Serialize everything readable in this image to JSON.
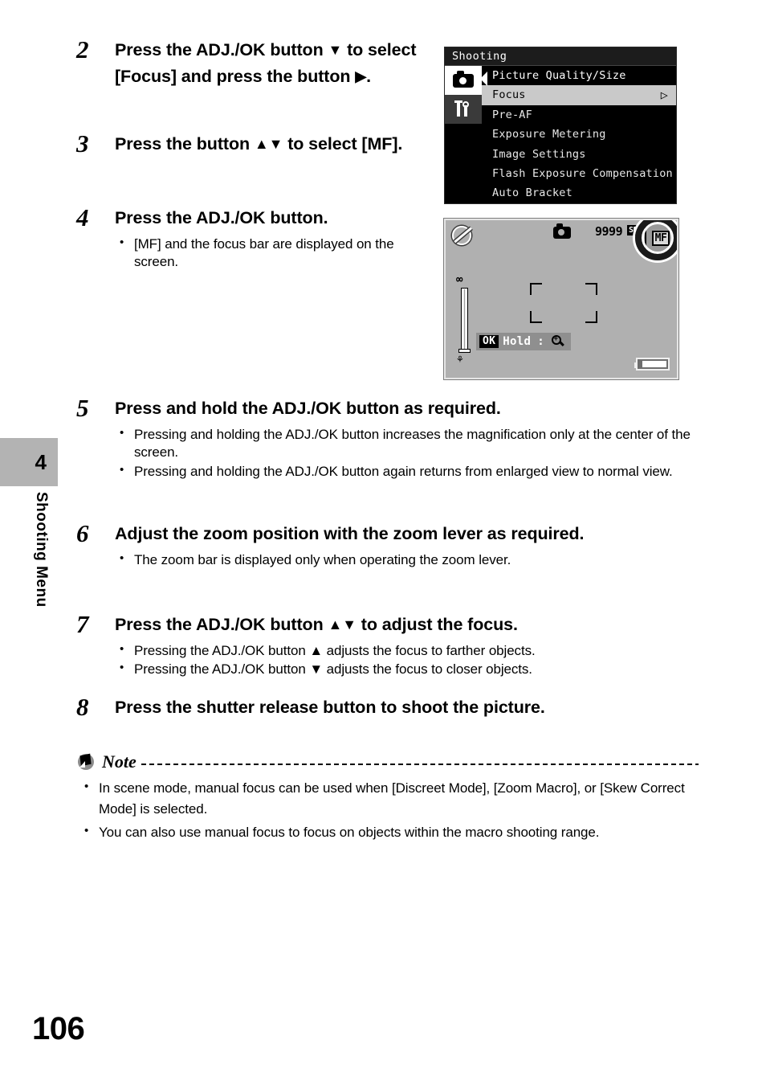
{
  "sidebar": {
    "chapter_number": "4",
    "chapter_label": "Shooting Menu"
  },
  "page_number": "106",
  "steps": [
    {
      "number": "2",
      "title_part1": "Press the ADJ./OK button ",
      "title_arrow1": "▼",
      "title_part2": " to select [Focus] and press the button ",
      "title_arrow2": "▶",
      "title_part3": ".",
      "bullets": []
    },
    {
      "number": "3",
      "title_part1": "Press the button ",
      "title_arrow1": "▲▼",
      "title_part2": " to select [MF].",
      "bullets": []
    },
    {
      "number": "4",
      "title_part1": "Press the ADJ./OK button.",
      "bullets": [
        "[MF] and the focus bar are displayed on the screen."
      ]
    },
    {
      "number": "5",
      "title_part1": "Press and hold the ADJ./OK button as required.",
      "bullets": [
        "Pressing and holding the ADJ./OK button increases the magnification only at the center of the screen.",
        "Pressing and holding the ADJ./OK button again returns from enlarged view to normal view."
      ]
    },
    {
      "number": "6",
      "title_part1": "Adjust the zoom position with the zoom lever as required.",
      "bullets": [
        "The zoom bar is displayed only when operating the zoom lever."
      ]
    },
    {
      "number": "7",
      "title_part1": "Press the ADJ./OK button ",
      "title_arrow1": "▲▼",
      "title_part2": " to adjust the focus.",
      "bullets": [
        "Pressing the ADJ./OK button ▲ adjusts the focus to farther objects.",
        "Pressing the ADJ./OK button ▼ adjusts the focus to closer objects."
      ]
    },
    {
      "number": "8",
      "title_part1": "Press the shutter release button to shoot the picture.",
      "bullets": []
    }
  ],
  "note": {
    "title": "Note",
    "bullets": [
      "In scene mode, manual focus can be used when [Discreet Mode],  [Zoom Macro], or [Skew Correct Mode] is selected.",
      "You can also use manual focus to focus on objects within the macro shooting range."
    ]
  },
  "camera_menu": {
    "title": "Shooting",
    "tabs": [
      {
        "icon": "camera-icon",
        "state": "active"
      },
      {
        "icon": "setup-tools-icon",
        "state": "inactive"
      }
    ],
    "items": [
      {
        "label": "Picture Quality/Size",
        "selected": false,
        "has_submenu_arrow": false
      },
      {
        "label": "Focus",
        "selected": true,
        "has_submenu_arrow": true
      },
      {
        "label": "Pre-AF",
        "selected": false,
        "has_submenu_arrow": false
      },
      {
        "label": "Exposure Metering",
        "selected": false,
        "has_submenu_arrow": false
      },
      {
        "label": "Image Settings",
        "selected": false,
        "has_submenu_arrow": false
      },
      {
        "label": "Flash Exposure Compensation",
        "selected": false,
        "has_submenu_arrow": false
      },
      {
        "label": "Auto Bracket",
        "selected": false,
        "has_submenu_arrow": false
      }
    ],
    "submenu_arrow": "▷",
    "back_caret": "◀"
  },
  "camera_lcd": {
    "flash_icon": "flash-off-icon",
    "mode_icon": "still-camera-icon",
    "shots_remaining": "9999",
    "media_badge": "SD",
    "mode_text": "N",
    "focus_mode_badge": "MF",
    "focus_bar": {
      "top_symbol": "∞",
      "bottom_symbol": "macro-flower-icon"
    },
    "hold_bar": {
      "button_label": "OK",
      "action_label": "Hold",
      "separator": ":",
      "result_icon": "magnify-plus-icon"
    },
    "battery_icon": "battery-full-icon"
  },
  "colors": {
    "tab_gray": "#b3b3b3",
    "lcd_background": "#b0b0b0",
    "menu_background": "#000000",
    "menu_selected": "#c9c9c9"
  }
}
